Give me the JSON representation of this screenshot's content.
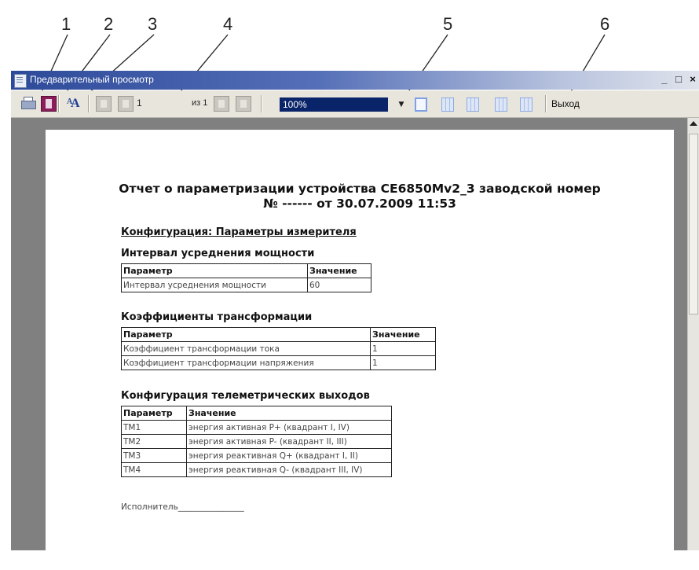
{
  "callouts": [
    "1",
    "2",
    "3",
    "4",
    "5",
    "6"
  ],
  "window": {
    "title": "Предварительный просмотр",
    "minimize": "_",
    "maximize": "□",
    "close": "×"
  },
  "toolbar": {
    "icons": [
      "printer-icon",
      "page-setup-icon",
      "font-icon",
      "first-page-icon",
      "prev-page-icon",
      "next-page-icon",
      "last-page-icon",
      "single-page-icon",
      "two-pages-icon",
      "four-pages-icon",
      "columns-icon",
      "grid-icon"
    ],
    "page_current": "1",
    "page_of": "из 1",
    "zoom_value": "100%",
    "exit_label": "Выход"
  },
  "report": {
    "title_line1": "Отчет  о параметризации устройства CE6850Mv2_3 заводской номер",
    "title_line2": "№ ------ от 30.07.2009 11:53",
    "section": "Конфигурация:  Параметры измерителя",
    "tables": [
      {
        "heading": "Интервал усреднения мощности",
        "headers": [
          "Параметр",
          "Значение"
        ],
        "rows": [
          [
            "Интервал усреднения мощности",
            "60"
          ]
        ]
      },
      {
        "heading": "Коэффициенты трансформации",
        "headers": [
          "Параметр",
          "Значение"
        ],
        "rows": [
          [
            "Коэффициент трансформации тока",
            "1"
          ],
          [
            "Коэффициент трансформации напряжения",
            "1"
          ]
        ]
      },
      {
        "heading": "Конфигурация телеметрических выходов",
        "headers": [
          "Параметр",
          "Значение"
        ],
        "rows": [
          [
            "TM1",
            "энергия активная P+ (квадрант I, IV)"
          ],
          [
            "TM2",
            "энергия активная P- (квадрант II, III)"
          ],
          [
            "TM3",
            "энергия реактивная Q+ (квадрант I, II)"
          ],
          [
            "TM4",
            "энергия реактивная Q- (квадрант III, IV)"
          ]
        ]
      }
    ],
    "executor": "Исполнитель________________"
  }
}
